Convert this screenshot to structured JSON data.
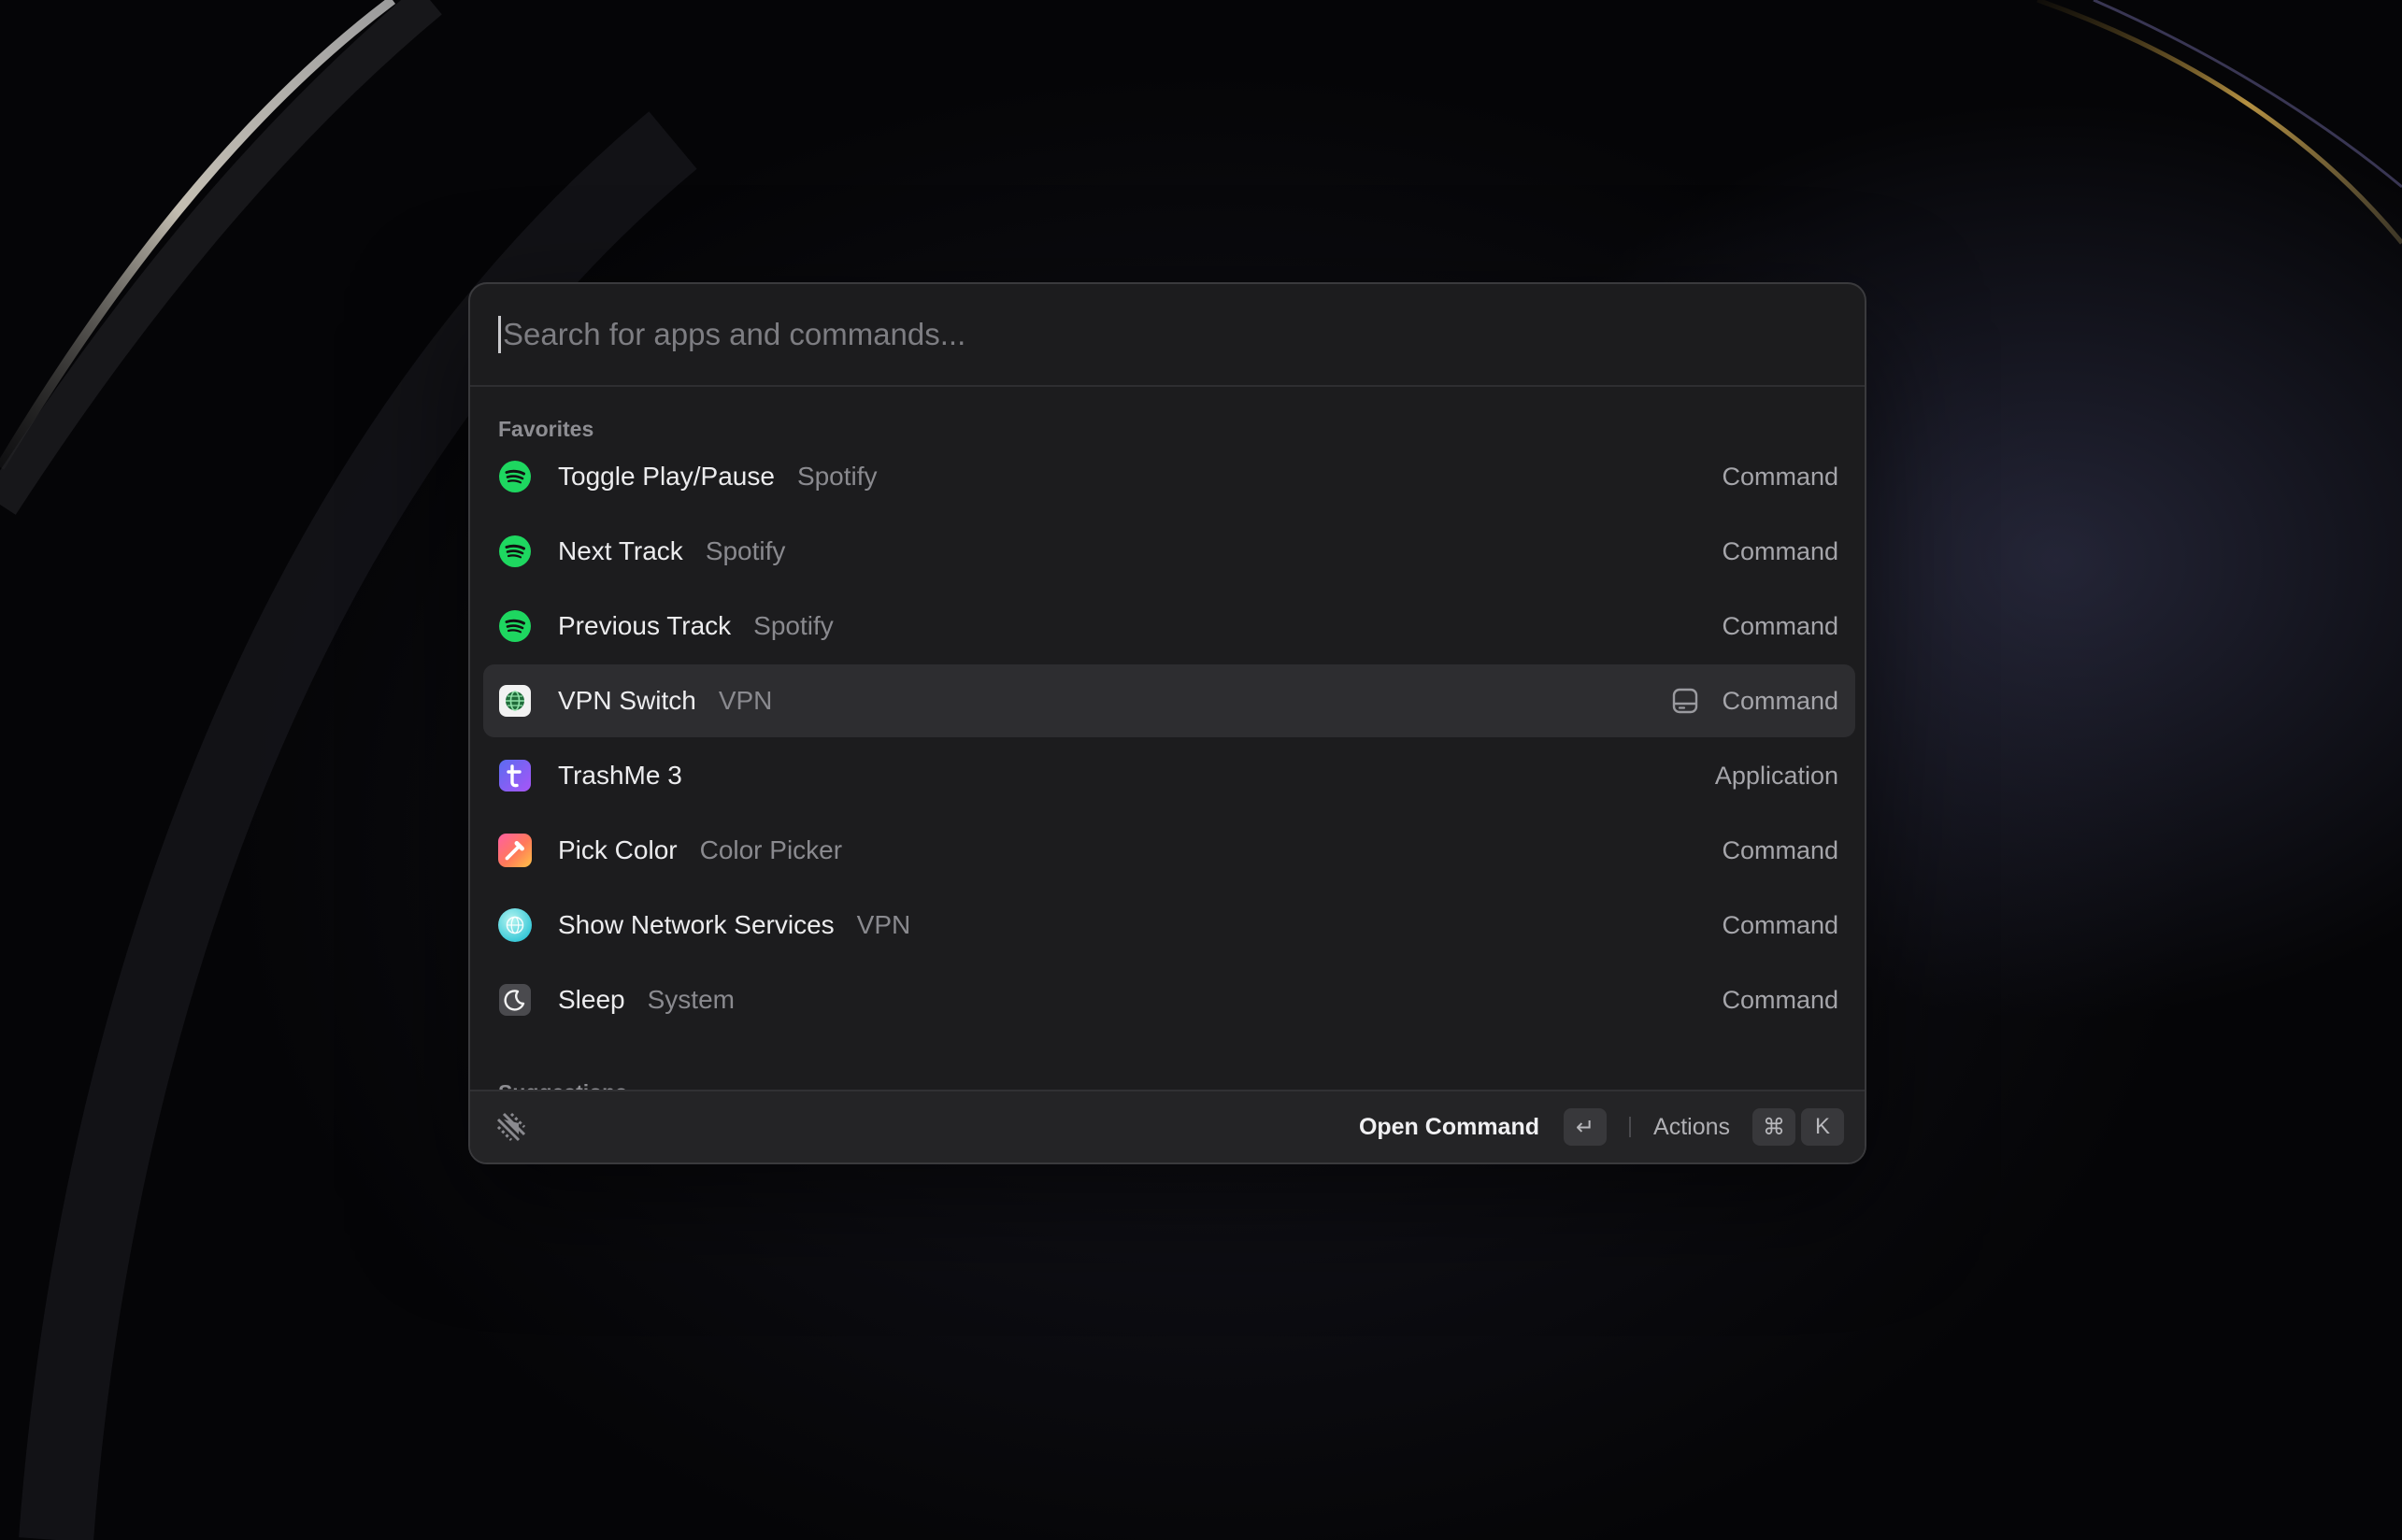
{
  "search": {
    "placeholder": "Search for apps and commands..."
  },
  "sections": {
    "favorites": "Favorites",
    "suggestions": "Suggestions"
  },
  "items": [
    {
      "title": "Toggle Play/Pause",
      "subtitle": "Spotify",
      "type": "Command",
      "icon": "spotify-icon"
    },
    {
      "title": "Next Track",
      "subtitle": "Spotify",
      "type": "Command",
      "icon": "spotify-icon"
    },
    {
      "title": "Previous Track",
      "subtitle": "Spotify",
      "type": "Command",
      "icon": "spotify-icon"
    },
    {
      "title": "VPN Switch",
      "subtitle": "VPN",
      "type": "Command",
      "icon": "vpn-globe-icon",
      "selected": true,
      "accessory": "storage-icon"
    },
    {
      "title": "TrashMe 3",
      "subtitle": "",
      "type": "Application",
      "icon": "trashme-icon"
    },
    {
      "title": "Pick Color",
      "subtitle": "Color Picker",
      "type": "Command",
      "icon": "color-picker-icon"
    },
    {
      "title": "Show Network Services",
      "subtitle": "VPN",
      "type": "Command",
      "icon": "network-globe-icon"
    },
    {
      "title": "Sleep",
      "subtitle": "System",
      "type": "Command",
      "icon": "moon-icon"
    }
  ],
  "footer": {
    "logo": "raycast-logo-icon",
    "primary_action": "Open Command",
    "primary_key": "↵",
    "secondary_action": "Actions",
    "secondary_keys": [
      "⌘",
      "K"
    ]
  },
  "colors": {
    "spotify": "#1ed760",
    "selected_row": "#2d2d30",
    "panel": "#1c1c1e"
  }
}
